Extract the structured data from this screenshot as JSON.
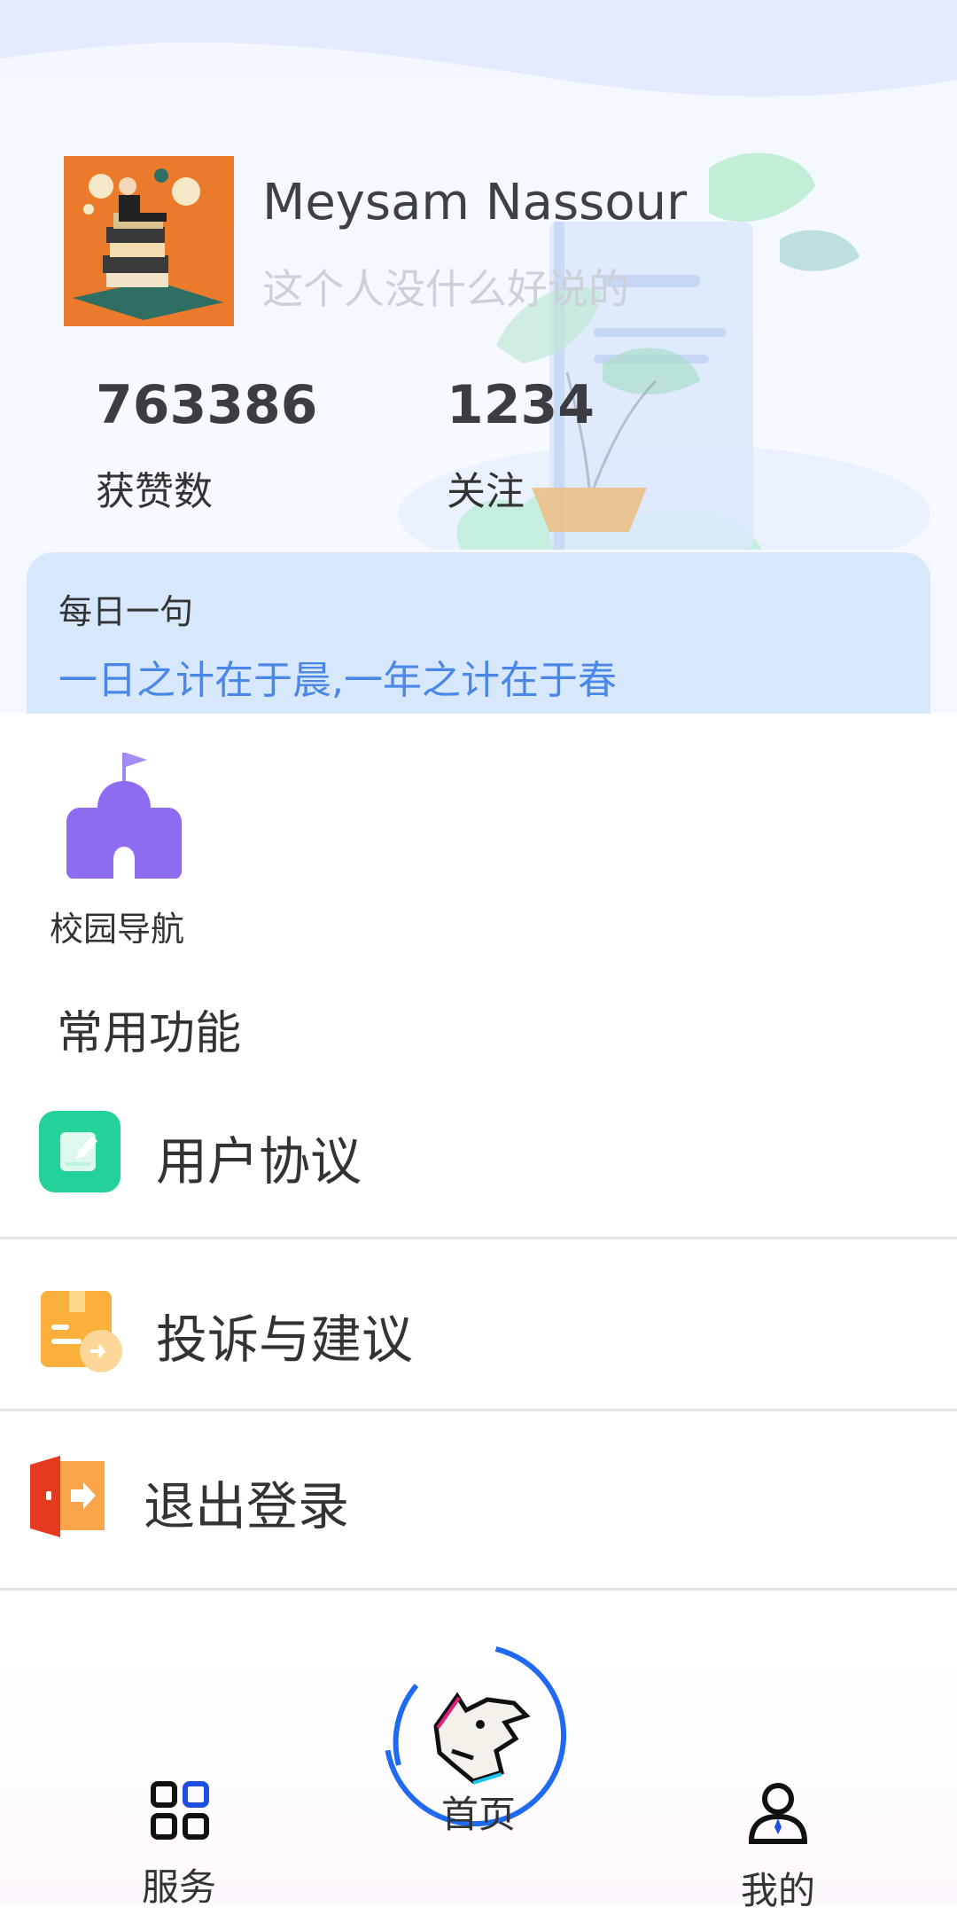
{
  "profile": {
    "name": "Meysam Nassour",
    "bio": "这个人没什么好说的"
  },
  "stats": [
    {
      "value": "763386",
      "label": "获赞数"
    },
    {
      "value": "1234",
      "label": "关注"
    }
  ],
  "daily_quote": {
    "title": "每日一句",
    "text": "一日之计在于晨,一年之计在于春"
  },
  "quick_nav": {
    "label": "校园导航",
    "icon": "campus-building-icon"
  },
  "common": {
    "title": "常用功能",
    "items": [
      {
        "label": "用户协议",
        "icon": "user-agreement-icon"
      },
      {
        "label": "投诉与建议",
        "icon": "complaint-suggestion-icon"
      },
      {
        "label": "退出登录",
        "icon": "logout-icon"
      }
    ]
  },
  "tabbar": {
    "items": [
      {
        "label": "服务",
        "icon": "grid-services-icon"
      },
      {
        "label": "首页",
        "icon": "wolf-logo-icon"
      },
      {
        "label": "我的",
        "icon": "user-profile-icon"
      }
    ],
    "active_color": "#1f6af0"
  },
  "colors": {
    "quote_bg": "#d7e8fd",
    "quote_text": "#4b87e8",
    "nav_purple": "#8e6cf2",
    "agreement_green": "#22d29a",
    "complaint_orange": "#fbb03b",
    "logout_red": "#e43a1f"
  }
}
